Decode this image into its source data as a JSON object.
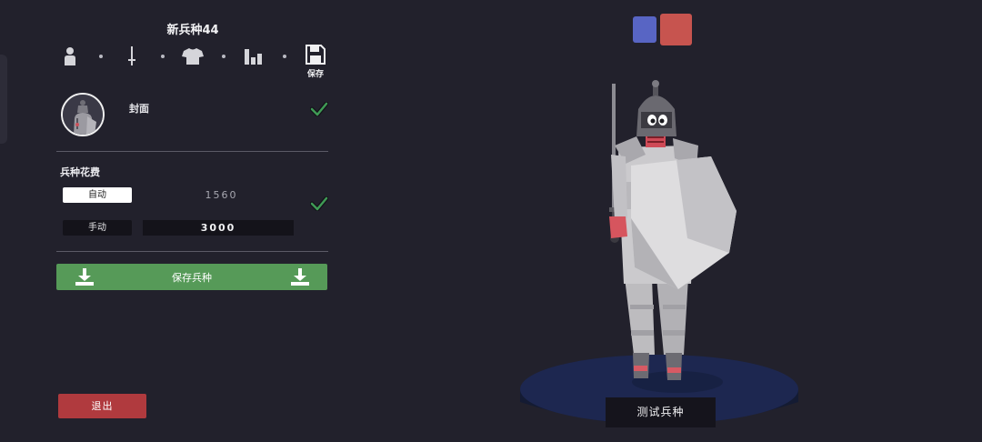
{
  "unit_editor": {
    "title": "新兵种44",
    "tabs": [
      {
        "name": "unit-base",
        "icon": "person-icon"
      },
      {
        "name": "weapons",
        "icon": "sword-icon"
      },
      {
        "name": "clothing",
        "icon": "shirt-icon"
      },
      {
        "name": "stats",
        "icon": "bar-chart-icon"
      }
    ],
    "save_tab_label": "保存",
    "cover_label": "封面",
    "cost_title": "兵种花费",
    "auto_label": "自动",
    "auto_value": "1560",
    "manual_label": "手动",
    "manual_value": "3000",
    "save_unit_label": "保存兵种",
    "exit_label": "退出"
  },
  "preview": {
    "team_colors": {
      "blue": "#5865c4",
      "red": "#c7544f"
    },
    "test_label": "测试兵种"
  },
  "colors": {
    "background": "#22212c",
    "save_green": "#569a58",
    "exit_red": "#b03a3e",
    "check_green": "#3f9a55"
  }
}
